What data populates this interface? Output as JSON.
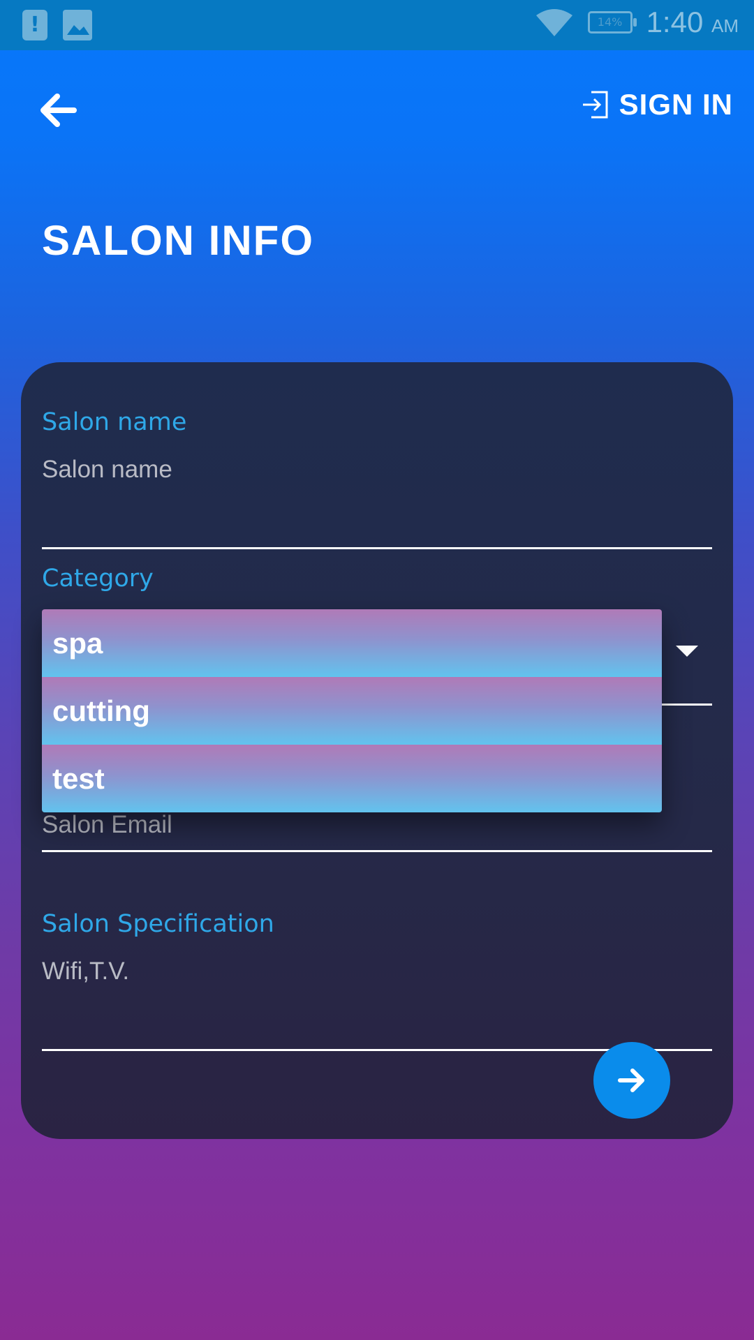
{
  "status_bar": {
    "time": "1:40",
    "ampm": "AM",
    "battery": "14%",
    "icons": [
      "alert-icon",
      "image-icon",
      "wifi-icon",
      "battery-icon"
    ]
  },
  "header": {
    "back_icon": "arrow-left-icon",
    "signin_label": "SIGN IN",
    "signin_icon": "sign-in-icon"
  },
  "title": "SALON INFO",
  "form": {
    "salon_name": {
      "label": "Salon name",
      "placeholder": "Salon name"
    },
    "category": {
      "label": "Category",
      "options": [
        "spa",
        "cutting",
        "test"
      ]
    },
    "salon_email": {
      "placeholder": "Salon Email"
    },
    "salon_specification": {
      "label": "Salon Specification",
      "placeholder": "Wifi,T.V."
    }
  },
  "next_icon": "arrow-right-icon",
  "colors": {
    "gradient_top": "#0778FB",
    "gradient_bottom": "#8A2B93",
    "card": "#232A4A",
    "label_accent": "#2FA8E8",
    "next_button": "#0A8CEB"
  }
}
